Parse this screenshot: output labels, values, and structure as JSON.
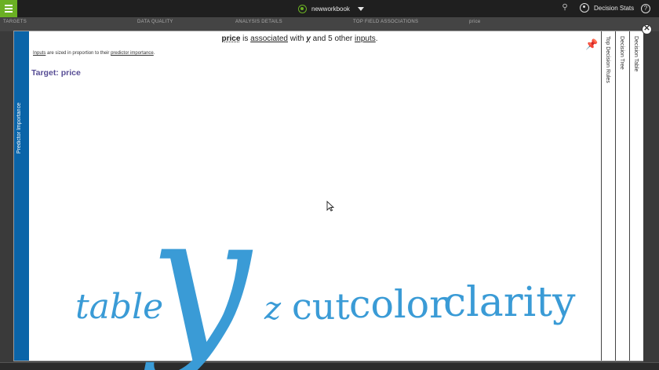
{
  "topbar": {
    "workbook_name": "newworkbook",
    "user_name": "Decision Stats",
    "help_label": "?"
  },
  "background_tiles": [
    "TARGETS",
    "DATA QUALITY",
    "ANALYSIS DETAILS",
    "TOP FIELD ASSOCIATIONS",
    "price"
  ],
  "modal": {
    "left_tab_label": "Predictor Importance",
    "headline": {
      "target": "price",
      "text1": " is ",
      "associated": "associated",
      "text2": " with ",
      "top_input": "y",
      "text3": " and 5 other ",
      "inputs": "inputs",
      "text4": "."
    },
    "subnote": {
      "inputs": "Inputs",
      "text1": " are sized in proportion to their ",
      "predictor_importance": "predictor importance",
      "text2": "."
    },
    "target_label": "Target: price",
    "word_cloud": [
      {
        "word": "table",
        "style": "italic",
        "importance": 0.18
      },
      {
        "word": "y",
        "style": "italic",
        "importance": 1.0
      },
      {
        "word": "z",
        "style": "italic",
        "importance": 0.16
      },
      {
        "word": "cut",
        "style": "normal",
        "importance": 0.17
      },
      {
        "word": "color",
        "style": "normal",
        "importance": 0.19
      },
      {
        "word": "clarity",
        "style": "normal",
        "importance": 0.21
      }
    ],
    "right_tabs": [
      "Top Decision Rules",
      "Decision Tree",
      "Decision Table"
    ]
  },
  "colors": {
    "accent_green": "#6ab023",
    "tab_blue": "#0a64a8",
    "word_blue": "#3a9bd6",
    "target_purple": "#574d95"
  }
}
